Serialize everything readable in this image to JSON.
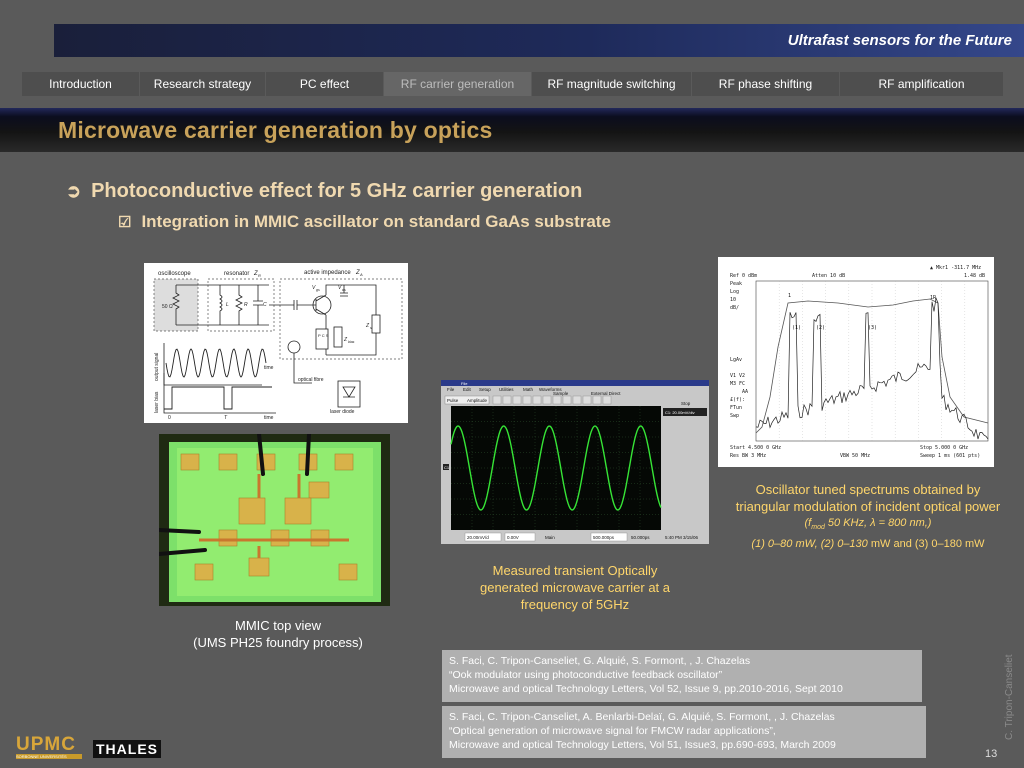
{
  "header": {
    "slogan": "Ultrafast sensors for the Future"
  },
  "nav": {
    "tabs": [
      {
        "label": "Introduction",
        "active": false
      },
      {
        "label": "Research strategy",
        "active": false
      },
      {
        "label": "PC effect",
        "active": false
      },
      {
        "label": "RF carrier generation",
        "active": true
      },
      {
        "label": "RF  magnitude switching",
        "active": false
      },
      {
        "label": "RF  phase shifting",
        "active": false
      },
      {
        "label": "RF  amplification",
        "active": false
      }
    ]
  },
  "slide": {
    "title": "Microwave carrier generation by optics",
    "bullet1": "Photoconductive effect for 5 GHz carrier generation",
    "bullet2": "Integration in MMIC ascillator on standard GaAs substrate",
    "bullet1_marker": "➲",
    "bullet2_marker": "☑"
  },
  "circuit": {
    "labels": {
      "oscilloscope": "oscilloscope",
      "resonator": "resonator",
      "zr": "Z",
      "zr_sub": "R",
      "active": "active impedance",
      "za": "Z",
      "za_sub": "A",
      "ohm50": "50 Ω",
      "L": "L",
      "R": "R",
      "C": "C",
      "vgs": "V",
      "vgs_sub": "gs",
      "vds": "V",
      "vds_sub": "ds",
      "zs": "Z",
      "zs_sub": "s",
      "zbias": "Z",
      "zbias_sub": "bias",
      "pcs": "P C S",
      "output_signal": "output signal",
      "laser_bias": "laser bias",
      "time1": "time",
      "time2": "time",
      "zero": "0",
      "T": "T",
      "optical_fibre": "optical fibre",
      "laser_diode": "laser diode"
    }
  },
  "scope": {
    "menu": "File  Edit  Setup  Utilities  Math  Waveforms",
    "mode": "Sample",
    "trigger": "External Direct",
    "scale": "20.00mV/d",
    "timebase": "500.000ps",
    "time": "5:40 PM  3/15/06",
    "menu_file": "File",
    "menu_edit": "Edit",
    "menu_setup": "Setup",
    "menu_util": "Utilities",
    "menu_math": "Math",
    "menu_wave": "Waveforms",
    "p_pulse": "Pulse",
    "p_amp": "Amplitude",
    "p_main": "Main",
    "p_zero": "0.00V",
    "p_offset": "50.000ps",
    "p_cursor": "C1: 20.00mV/div",
    "p_ch": "C1",
    "p_stop": "Stop"
  },
  "spectrum": {
    "ref": "Ref 0 dBm",
    "peak": "Peak",
    "log": "Log",
    "div": "10",
    "unit": "dB/",
    "atten": "Atten 10 dB",
    "marker": "▲ Mkr1  -311.7 MHz",
    "marker_db": "1.48 dB",
    "lgav": "LgAv",
    "v1v2": "V1  V2",
    "m3fc": "M3 FC",
    "aa": "AA",
    "corr": "£(f):",
    "ftun": "FTun",
    "swp": "Swp",
    "start": "Start 4.500 0 GHz",
    "stop": "Stop 5.000 0 GHz",
    "res": "Res BW 3 MHz",
    "vbw": "VBW 50 MHz",
    "sweep": "Sweep 1 ms (601 pts)",
    "curve1": "(1)",
    "curve2": "(2)",
    "curve3": "(3)",
    "mk1": "1",
    "mk1r": "1R"
  },
  "chip": {
    "alt": ""
  },
  "captions": {
    "mmic_line1": "MMIC top view",
    "mmic_line2": "(UMS PH25 foundry process)",
    "scope_line1": "Measured transient Optically",
    "scope_line2": "generated microwave carrier at a",
    "scope_line3": "frequency of 5GHz",
    "spec_line1": "Oscillator tuned spectrums obtained by",
    "spec_line2": "triangular modulation of incident optical power",
    "spec_line3_a": "(f",
    "spec_line3_sub": "mod",
    "spec_line3_b": " 50 KHz,   λ = 800 nm,)",
    "spec_line4_a": "(1) 0–80 mW, (2) 0–130",
    "spec_line4_b": " mW and (3) 0–180 mW"
  },
  "references": [
    {
      "authors": "S. Faci, C. Tripon-Canseliet, G. Alquié, S. Formont, , J. Chazelas",
      "title": "“Ook modulator using photoconductive feedback oscillator”",
      "journal": "Microwave and optical Technology Letters, Vol 52, Issue 9, pp.2010-2016, Sept 2010"
    },
    {
      "authors": "S. Faci, C. Tripon-Canseliet, A. Benlarbi-Delaï, G. Alquié, S. Formont, , J. Chazelas",
      "title": "“Optical generation of microwave signal for FMCW radar applications”,",
      "journal": "Microwave and optical Technology Letters, Vol 51, Issue3, pp.690-693, March 2009"
    }
  ],
  "footer": {
    "upmc": "UPMC",
    "upmc_sub": "SORBONNE UNIVERSITÉS",
    "thales": "THALES",
    "page": "13",
    "author": "C. Tripon-Canseliet"
  },
  "colors": {
    "background": "#5a5a5a",
    "title": "#c8a25a",
    "bullet": "#f0d9b0",
    "caption": "#ffd66b",
    "trace": "#36e436",
    "band": "#1e2a5a"
  }
}
